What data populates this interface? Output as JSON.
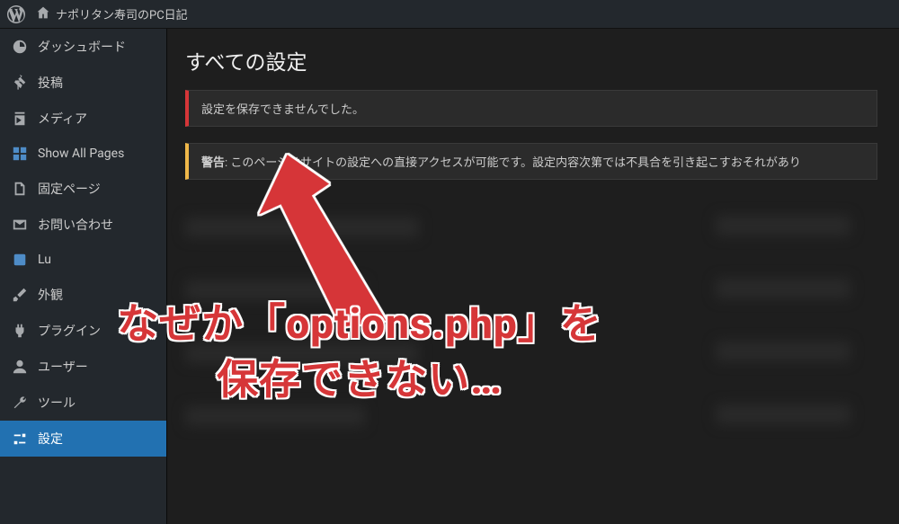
{
  "toolbar": {
    "site_title": "ナポリタン寿司のPC日記"
  },
  "sidebar": {
    "items": [
      {
        "label": "ダッシュボード"
      },
      {
        "label": "投稿"
      },
      {
        "label": "メディア"
      },
      {
        "label": "Show All Pages"
      },
      {
        "label": "固定ページ"
      },
      {
        "label": "お問い合わせ"
      },
      {
        "label": "Lu"
      },
      {
        "label": "外観"
      },
      {
        "label": "プラグイン"
      },
      {
        "label": "ユーザー"
      },
      {
        "label": "ツール"
      },
      {
        "label": "設定"
      }
    ]
  },
  "content": {
    "title": "すべての設定",
    "notice_error": "設定を保存できませんでした。",
    "notice_warning_label": "警告",
    "notice_warning_text": ": このページはサイトの設定への直接アクセスが可能です。設定内容次第では不具合を引き起こすおそれがあり"
  },
  "annotation": {
    "line1": "なぜか「options.php」を",
    "line2": "保存できない…"
  },
  "colors": {
    "background": "#1e1e1e",
    "panel": "#23282d",
    "accent_blue": "#2271b1",
    "error": "#d63638",
    "warning": "#f0b849"
  }
}
